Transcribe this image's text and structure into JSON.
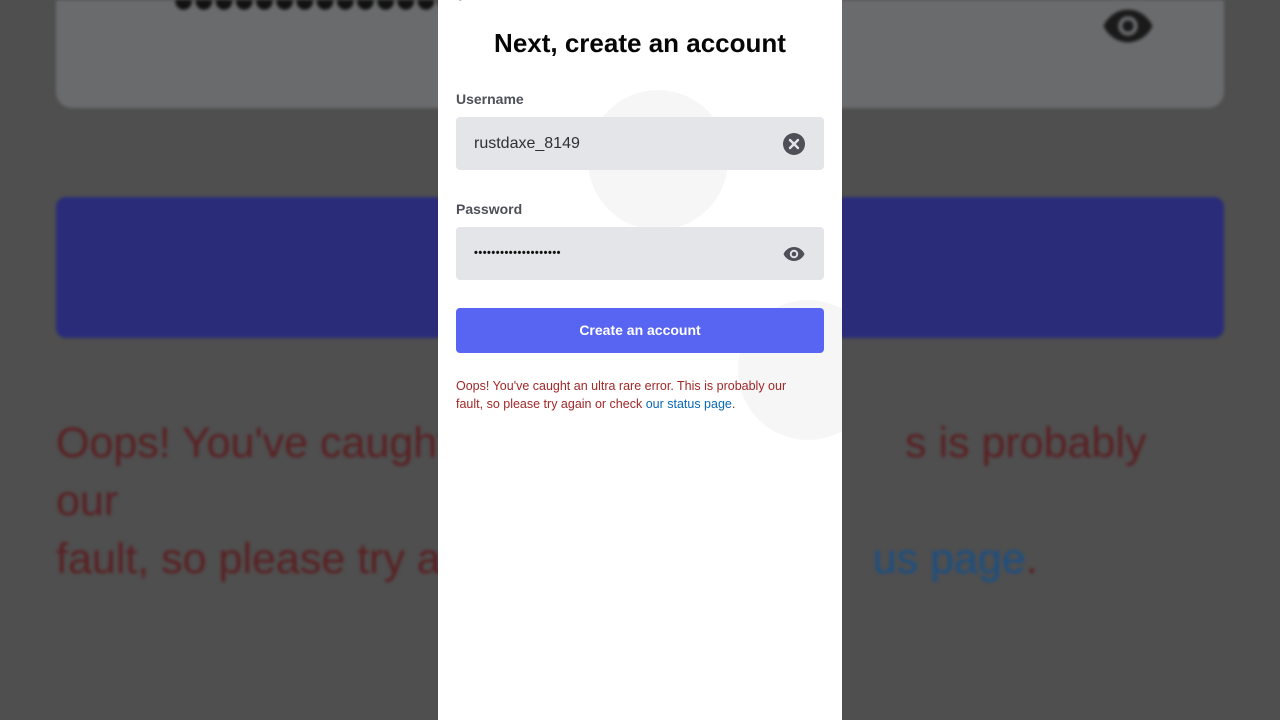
{
  "screen": {
    "title": "Next, create an account",
    "back_icon": "chevron-left-icon"
  },
  "username": {
    "label": "Username",
    "value": "rustdaxe_8149",
    "clear_icon": "clear-x-icon"
  },
  "password": {
    "label": "Password",
    "value": "••••••••••••••••••••",
    "toggle_icon": "eye-icon"
  },
  "submit": {
    "label": "Create an account"
  },
  "error": {
    "message": "Oops! You've caught an ultra rare error. This is probably our fault, so please try again or check ",
    "link_text": "our status page",
    "trailing": "."
  },
  "background": {
    "password_dots": "●●●●●●●●●●●●●●●●●●●",
    "error_line_1_start": "Oops! You've caught a",
    "error_line_1_end": "s is probably our",
    "error_line_2_start": "fault, so please try ag",
    "error_link_fragment": "us page",
    "error_period": "."
  },
  "colors": {
    "accent": "#5865f2",
    "error": "#a12828",
    "link": "#0a67b5",
    "field_bg": "#e3e5e8"
  }
}
